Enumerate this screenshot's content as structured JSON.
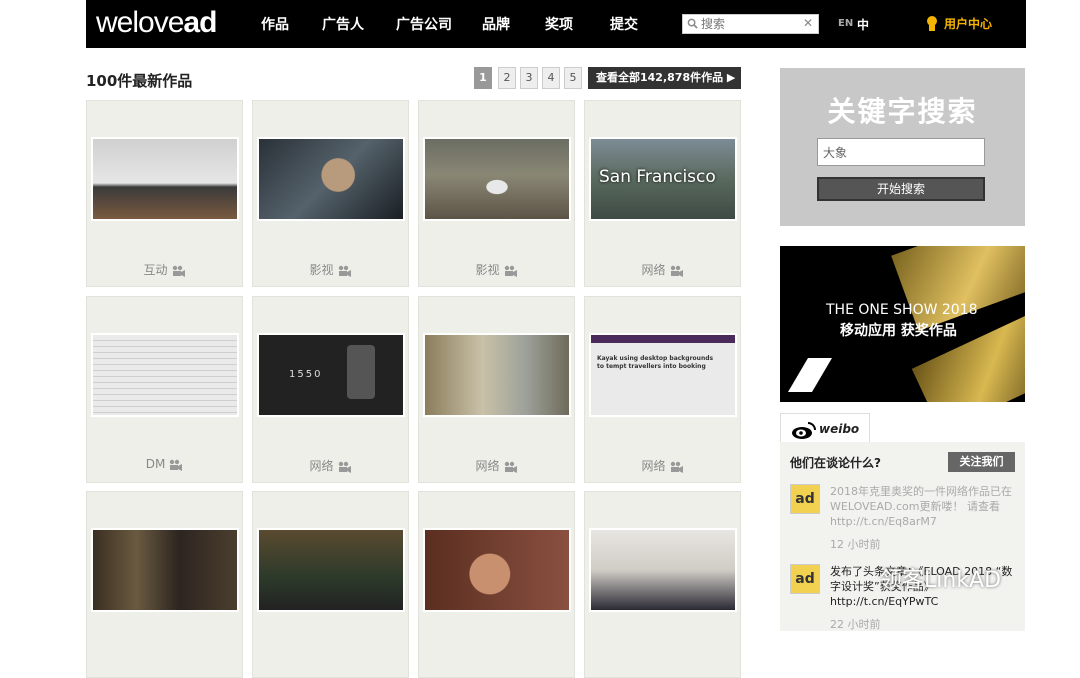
{
  "header": {
    "logo_light": "welove",
    "logo_bold": "ad",
    "nav": [
      "作品",
      "广告人",
      "广告公司",
      "品牌",
      "奖项",
      "提交"
    ],
    "search_placeholder": "搜索",
    "lang_en": "EN",
    "lang_zh": "中",
    "user_center": "用户中心"
  },
  "main": {
    "heading": "100件最新作品",
    "pages": [
      "1",
      "2",
      "3",
      "4",
      "5"
    ],
    "view_all": "查看全部142,878件作品 ▶",
    "cards": [
      {
        "category": "互动"
      },
      {
        "category": "影视"
      },
      {
        "category": "影视"
      },
      {
        "category": "网络",
        "thumb_text": "San Francisco"
      },
      {
        "category": "DM"
      },
      {
        "category": "网络",
        "thumb_text": "1550"
      },
      {
        "category": "网络"
      },
      {
        "category": "网络",
        "thumb_text": "Kayak using desktop backgrounds to tempt travellers into booking"
      },
      {
        "category": ""
      },
      {
        "category": ""
      },
      {
        "category": ""
      },
      {
        "category": ""
      }
    ]
  },
  "sidebar": {
    "keyword_title": "关键字搜索",
    "keyword_value": "大象",
    "search_button": "开始搜索",
    "banner_line1": "THE ONE SHOW 2018",
    "banner_line2": "移动应用 获奖作品",
    "weibo_tab": "weibo",
    "weibo_question": "他们在谈论什么?",
    "follow": "关注我们",
    "posts": [
      {
        "avatar": "ad",
        "text": "2018年克里奥奖的一件网络作品已在WELOVEAD.com更新喽！ 请查看http://t.cn/Eq8arM7",
        "time": "12 小时前"
      },
      {
        "avatar": "ad",
        "text": "发布了头条文章：《ELOAD 2018 “数字设计奖”获奖作品》 http://t.cn/EqYPwTC",
        "time": "22 小时前"
      }
    ]
  },
  "watermark": "领客LinkAD"
}
